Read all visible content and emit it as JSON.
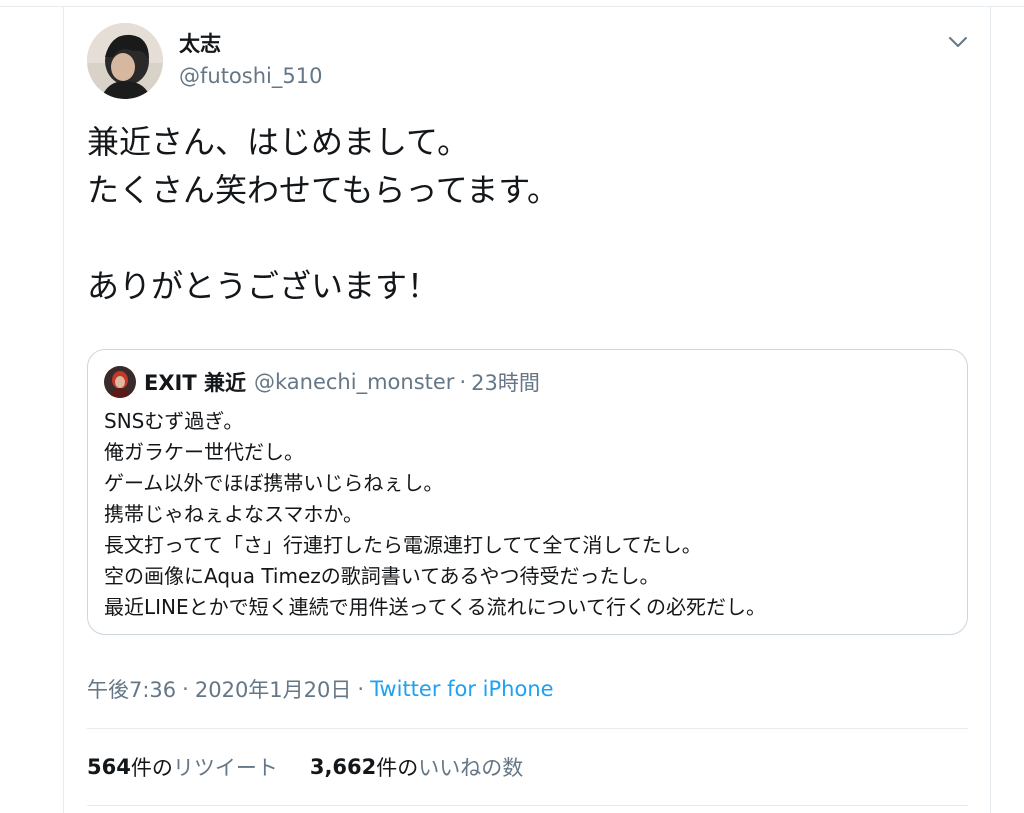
{
  "tweet": {
    "author": {
      "display_name": "太志",
      "handle": "@futoshi_510"
    },
    "menu_icon": "chevron-down-icon",
    "text_lines": [
      "兼近さん、はじめまして。",
      "たくさん笑わせてもらってます。",
      "",
      "ありがとうございます！"
    ],
    "quote": {
      "display_name": "EXIT 兼近",
      "handle": "@kanechi_monster",
      "separator": "·",
      "time": "23時間",
      "text_lines": [
        "SNSむず過ぎ。",
        "俺ガラケー世代だし。",
        "ゲーム以外でほぼ携帯いじらねぇし。",
        "携帯じゃねぇよなスマホか。",
        "長文打ってて「さ」行連打したら電源連打してて全て消してたし。",
        "空の画像にAqua Timezの歌詞書いてあるやつ待受だったし。",
        "最近LINEとかで短く連続で用件送ってくる流れについて行くの必死だし。"
      ]
    },
    "meta": {
      "time": "午後7:36",
      "dot1": "·",
      "date": "2020年1月20日",
      "dot2": "·",
      "source": "Twitter for iPhone"
    },
    "stats": {
      "retweets": {
        "count": "564",
        "unit": "件の",
        "label": "リツイート"
      },
      "likes": {
        "count": "3,662",
        "unit": "件の",
        "label": "いいねの数"
      }
    }
  },
  "colors": {
    "text": "#14171a",
    "secondary": "#657786",
    "link": "#1da1f2",
    "border": "#ccd6dd",
    "divider": "#e6ecf0"
  }
}
